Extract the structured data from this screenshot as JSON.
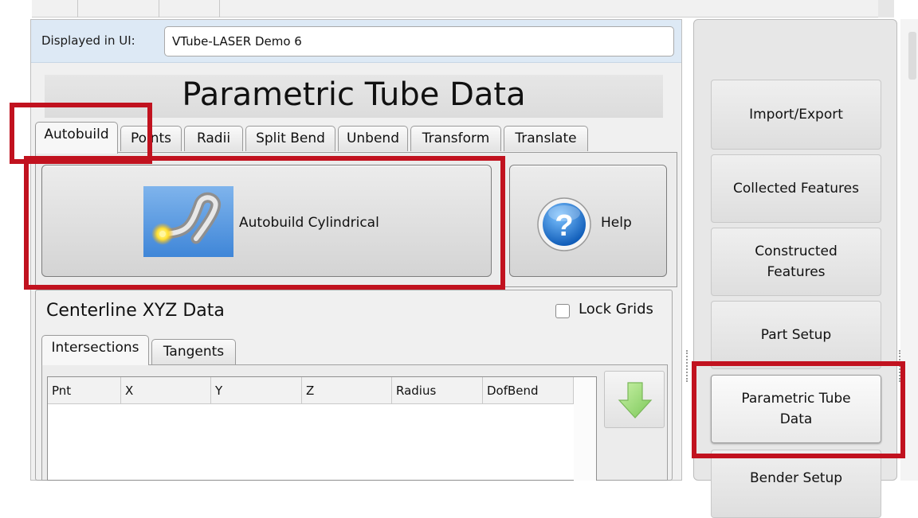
{
  "display": {
    "label": "Displayed in UI:",
    "value": "VTube-LASER Demo 6"
  },
  "page_title": "Parametric Tube Data",
  "tabs": [
    {
      "label": "Autobuild",
      "active": true
    },
    {
      "label": "Points"
    },
    {
      "label": "Radii"
    },
    {
      "label": "Split Bend"
    },
    {
      "label": "Unbend"
    },
    {
      "label": "Transform"
    },
    {
      "label": "Translate"
    }
  ],
  "actions": {
    "autobuild_label": "Autobuild Cylindrical",
    "help_label": "Help"
  },
  "centerline": {
    "title": "Centerline XYZ Data",
    "lock_label": "Lock Grids",
    "lock_checked": false,
    "subtabs": [
      {
        "label": "Intersections",
        "active": true
      },
      {
        "label": "Tangents"
      }
    ],
    "columns": [
      "Pnt",
      "X",
      "Y",
      "Z",
      "Radius",
      "DofBend"
    ]
  },
  "nav": {
    "buttons": [
      {
        "label": "Import/Export"
      },
      {
        "label": "Collected Features"
      },
      {
        "label": "Constructed Features"
      },
      {
        "label": "Part Setup"
      },
      {
        "label": "Parametric Tube Data",
        "active": true
      },
      {
        "label": "Bender Setup"
      }
    ]
  },
  "colors": {
    "highlight": "#c1121f",
    "display_bar": "#dde9f5"
  }
}
